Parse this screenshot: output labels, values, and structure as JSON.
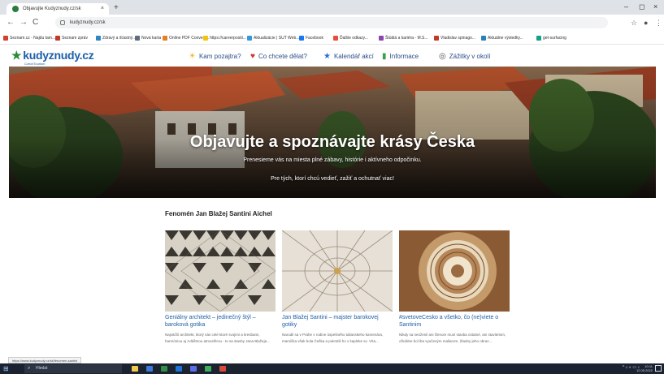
{
  "browser": {
    "tab_title": "Objavujte Kudyznudy.cz/sk",
    "new_tab": "+",
    "address": "kudyznudy.cz/sk",
    "window_controls": {
      "minimize": "–",
      "maximize": "◻",
      "close": "×"
    },
    "nav": {
      "back": "←",
      "forward": "→",
      "reload": "C"
    }
  },
  "bookmarks": [
    {
      "label": "Seznam.cz - Najdu tam...",
      "color": "#d23f31"
    },
    {
      "label": "Seznam zpráv",
      "color": "#c0392b"
    },
    {
      "label": "Zdravý a šťastný...",
      "color": "#2e86c1"
    },
    {
      "label": "Nová karta",
      "color": "#5d6d7e"
    },
    {
      "label": "Online PDF Convert...",
      "color": "#e67e22"
    },
    {
      "label": "https://careerpositi...",
      "color": "#f1c40f"
    },
    {
      "label": "Aktualizácie | SUT Web...",
      "color": "#3498db"
    },
    {
      "label": "Facebook",
      "color": "#1877f2"
    },
    {
      "label": "Ďalšie odkazy...",
      "color": "#e74c3c"
    },
    {
      "label": "Štúdiá a kariéra - M.S...",
      "color": "#8e44ad"
    },
    {
      "label": "Vladislav spinago...",
      "color": "#c0392b"
    },
    {
      "label": "Aktuálne výsledky...",
      "color": "#2980b9"
    },
    {
      "label": "get-surfacing",
      "color": "#16a085"
    }
  ],
  "site": {
    "logo": "kudyznudy.cz",
    "logo_sub": "CzechTourism",
    "nav": [
      {
        "label": "Kam pozajtra?",
        "icon": "sun-icon"
      },
      {
        "label": "Co chcete dělat?",
        "icon": "heart-icon"
      },
      {
        "label": "Kalendář akcí",
        "icon": "star-icon"
      },
      {
        "label": "Informace",
        "icon": "chart-icon"
      },
      {
        "label": "Zážitky v okolí",
        "icon": "compass-icon"
      }
    ]
  },
  "hero": {
    "title": "Objavujte a spoznávajte krásy Česka",
    "subtitle1": "Prenesieme vás na miesta plné zábavy, histórie i aktívneho odpočinku.",
    "subtitle2": "Pre tých, ktorí chcú vedieť, zažiť a ochutnať viac!"
  },
  "section": {
    "title": "Fenomén Jan Blažej Santini Aichel",
    "cards": [
      {
        "title": "Geniálny architekt – jedinečný štýl – baroková gotika",
        "text": "Najväčší architekt, ktorý nás celé ktoré svojimi a kresbami, harmóniou aj zvláštnou atmosférou - to sa stavby Jana Blažeja..."
      },
      {
        "title": "Jan Blažej Santini – majster barokovej gotiky",
        "text": "Narodil sa v Prahe v rodine úspešného talianskeho kamenára, mamička však bola Češka a pokrstili ho v kaplnke sv. Víta..."
      },
      {
        "title": "#svetoveCesko a všetko, čo (ne)viete o Santinim",
        "text": "Nikdy sa neoženil ani členom musí stavba ostatné, ani stavitelom, oficiálne bol iba vyučeným maliarom. Žiadny jeho obraz..."
      }
    ]
  },
  "status_url": "https://www.kudyznudy.cz/sk/fenomen-santini",
  "taskbar": {
    "search": "Hledat",
    "clock_time": "10:11",
    "clock_date": "12.05.2022"
  }
}
